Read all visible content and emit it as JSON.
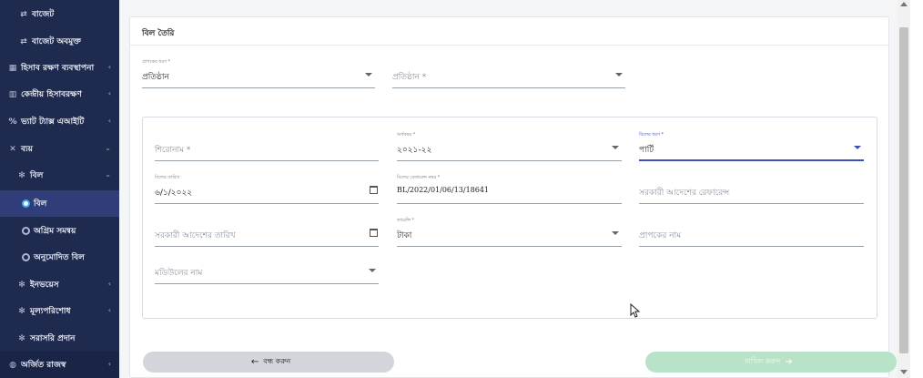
{
  "sidebar": {
    "items": [
      {
        "label": "বাজেট",
        "icon": "budget-icon"
      },
      {
        "label": "বাজেট অবমুক্ত",
        "icon": "budget-release-icon"
      },
      {
        "label": "হিসাব রক্ষণ ব্যবস্থাপনা",
        "icon": "accounting-icon"
      },
      {
        "label": "কেন্দ্রীয় হিসাবরক্ষণ",
        "icon": "central-accounting-icon"
      },
      {
        "label": "ভ্যাট ট্যাক্স এআইটি",
        "icon": "vat-tax-icon"
      },
      {
        "label": "ব্যয়",
        "icon": "expense-icon"
      },
      {
        "label": "বিল",
        "icon": "bill-group-icon"
      },
      {
        "label": "বিল",
        "icon": "radio-icon"
      },
      {
        "label": "অগ্রিম সমন্বয়",
        "icon": "radio-icon"
      },
      {
        "label": "অনুমোদিত বিল",
        "icon": "radio-icon"
      },
      {
        "label": "ইনভয়েস",
        "icon": "invoice-icon"
      },
      {
        "label": "মূল্যপরিশোধ",
        "icon": "payment-icon"
      },
      {
        "label": "সরাসরি প্রদান",
        "icon": "direct-payment-icon"
      },
      {
        "label": "অর্জিত রাজস্ব",
        "icon": "revenue-icon"
      }
    ]
  },
  "card": {
    "title": "বিল তৈরি"
  },
  "top_fields": {
    "recipient_type": {
      "label": "প্রাপকের ধরণ *",
      "value": "প্রতিষ্ঠান"
    },
    "institution": {
      "placeholder": "প্রতিষ্ঠান *"
    }
  },
  "form": {
    "heading": {
      "placeholder": "শিরোনাম *"
    },
    "fiscal_year": {
      "label": "অর্থবছর *",
      "value": "২০২১-২২"
    },
    "bill_type": {
      "label": "বিলের ধরণ *",
      "value": "পার্টি"
    },
    "bill_date": {
      "label": "বিলের তারিখ",
      "value": "৬/১/২০২২"
    },
    "bill_ref": {
      "label": "বিলের রেফারেন্স নম্বর *",
      "value": "BL/2022/01/06/13/18641"
    },
    "gov_order_ref": {
      "placeholder": "সরকারী আদেশের রেফারেন্স"
    },
    "gov_order_date": {
      "placeholder": "সরকারী আদেশের তারিখ"
    },
    "currency": {
      "label": "কারেন্সি *",
      "value": "টাকা"
    },
    "recipient_name": {
      "placeholder": "প্রাপকের নাম"
    },
    "module_name": {
      "placeholder": "মডিউলের নাম"
    }
  },
  "buttons": {
    "cancel": "বন্ধ করুন",
    "submit": "দাখিল করুন"
  },
  "icons": {
    "back_arrow": "←",
    "forward_arrow": "➔"
  },
  "colors": {
    "sidebar_bg": "#1f2a4f",
    "accent": "#3f51b5",
    "submit_bg": "#b9e3c8"
  }
}
